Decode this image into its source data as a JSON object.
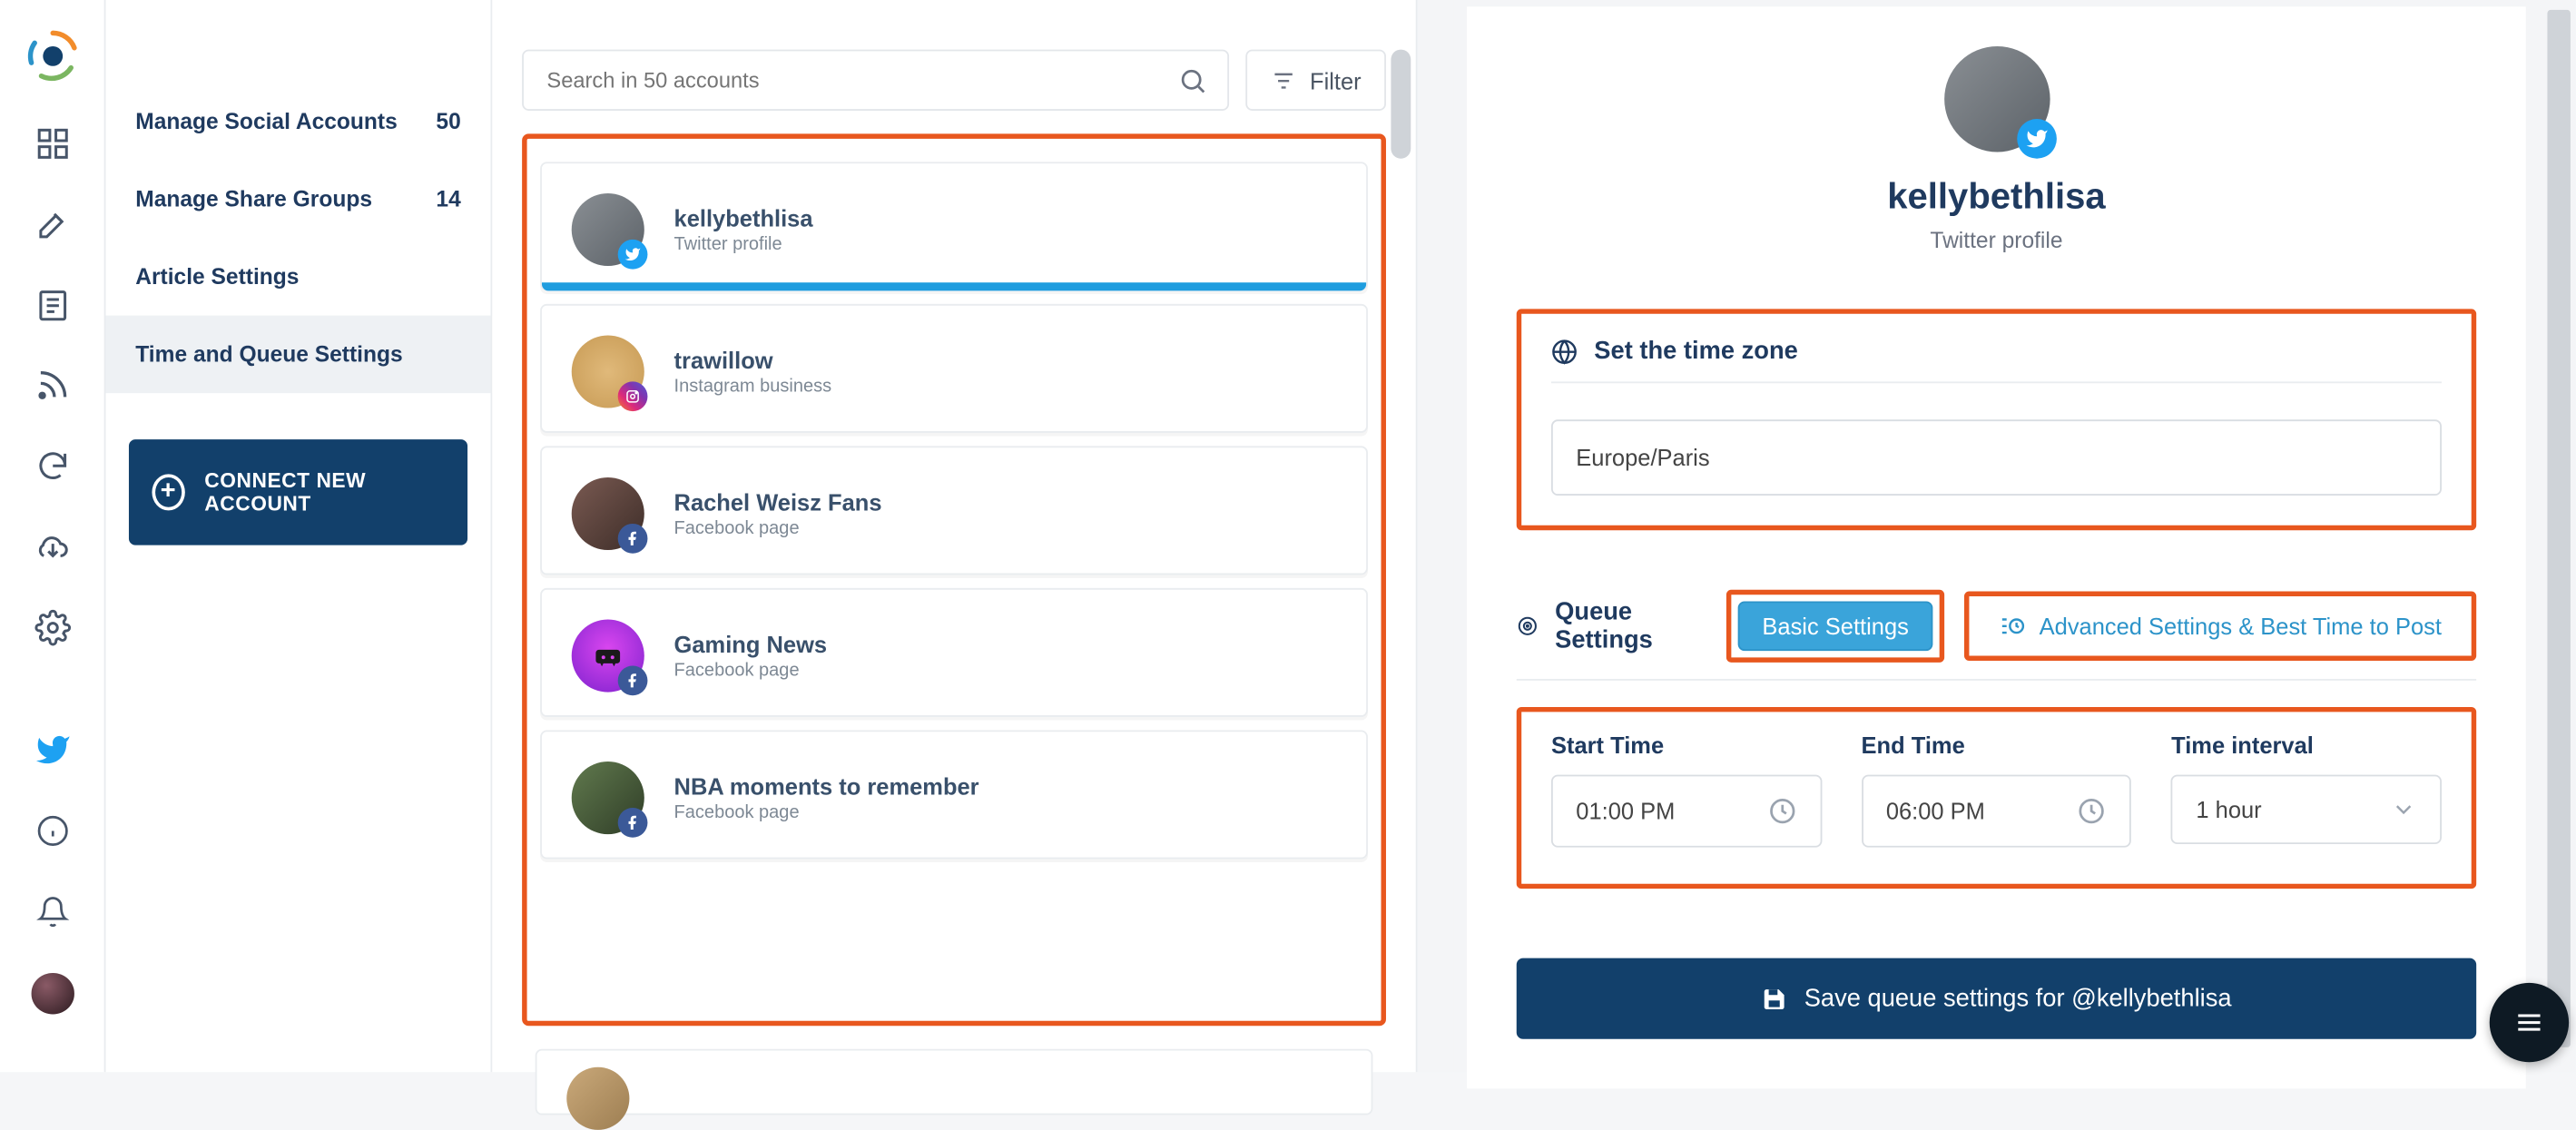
{
  "sidebar": {
    "items": [
      {
        "label": "Manage Social Accounts",
        "count": "50"
      },
      {
        "label": "Manage Share Groups",
        "count": "14"
      },
      {
        "label": "Article Settings",
        "count": ""
      },
      {
        "label": "Time and Queue Settings",
        "count": ""
      }
    ],
    "connect_label": "CONNECT NEW ACCOUNT"
  },
  "search": {
    "placeholder": "Search in 50 accounts"
  },
  "filter_label": "Filter",
  "accounts": [
    {
      "name": "kellybethlisa",
      "sub": "Twitter profile",
      "network": "tw"
    },
    {
      "name": "trawillow",
      "sub": "Instagram business",
      "network": "ig"
    },
    {
      "name": "Rachel Weisz Fans",
      "sub": "Facebook page",
      "network": "fb"
    },
    {
      "name": "Gaming News",
      "sub": "Facebook page",
      "network": "fb"
    },
    {
      "name": "NBA moments to remember",
      "sub": "Facebook page",
      "network": "fb"
    }
  ],
  "profile": {
    "name": "kellybethlisa",
    "sub": "Twitter profile"
  },
  "timezone": {
    "section_title": "Set the time zone",
    "value": "Europe/Paris"
  },
  "queue": {
    "section_title": "Queue Settings",
    "basic_label": "Basic Settings",
    "advanced_label": "Advanced Settings & Best Time to Post",
    "start_label": "Start Time",
    "end_label": "End Time",
    "interval_label": "Time interval",
    "start_value": "01:00 PM",
    "end_value": "06:00 PM",
    "interval_value": "1 hour"
  },
  "save_label": "Save queue settings for @kellybethlisa",
  "colors": {
    "accent": "#12406b",
    "highlight": "#e8571e",
    "link": "#2c93c9"
  }
}
